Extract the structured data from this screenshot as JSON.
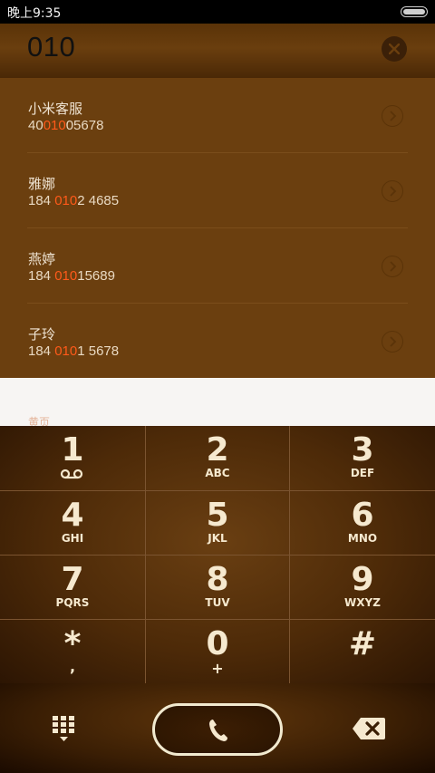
{
  "status_bar": {
    "time": "晚上9:35"
  },
  "dialer": {
    "number": "010"
  },
  "results": [
    {
      "name": "小米客服",
      "number_pre": "40",
      "number_match": "010",
      "number_post": "05678"
    },
    {
      "name": "雅娜",
      "number_pre": "184 ",
      "number_match": "010",
      "number_post": "2 4685"
    },
    {
      "name": "燕婷",
      "number_pre": "184 ",
      "number_match": "010",
      "number_post": "15689"
    },
    {
      "name": "子玲",
      "number_pre": "184 ",
      "number_match": "010",
      "number_post": "1 5678"
    }
  ],
  "section_label": "黄页",
  "keys": [
    {
      "digit": "1",
      "letters": ""
    },
    {
      "digit": "2",
      "letters": "ABC"
    },
    {
      "digit": "3",
      "letters": "DEF"
    },
    {
      "digit": "4",
      "letters": "GHI"
    },
    {
      "digit": "5",
      "letters": "JKL"
    },
    {
      "digit": "6",
      "letters": "MNO"
    },
    {
      "digit": "7",
      "letters": "PQRS"
    },
    {
      "digit": "8",
      "letters": "TUV"
    },
    {
      "digit": "9",
      "letters": "WXYZ"
    },
    {
      "digit": "*",
      "letters": ","
    },
    {
      "digit": "0",
      "letters": "+"
    },
    {
      "digit": "#",
      "letters": ""
    }
  ],
  "icons": {
    "voicemail": "voicemail-icon",
    "clear": "close-icon",
    "chevron": "chevron-right-icon",
    "dialpad": "dialpad-icon",
    "call": "phone-icon",
    "backspace": "backspace-icon"
  },
  "colors": {
    "highlight": "#ff5a1a",
    "accent": "#f6e9cf"
  }
}
